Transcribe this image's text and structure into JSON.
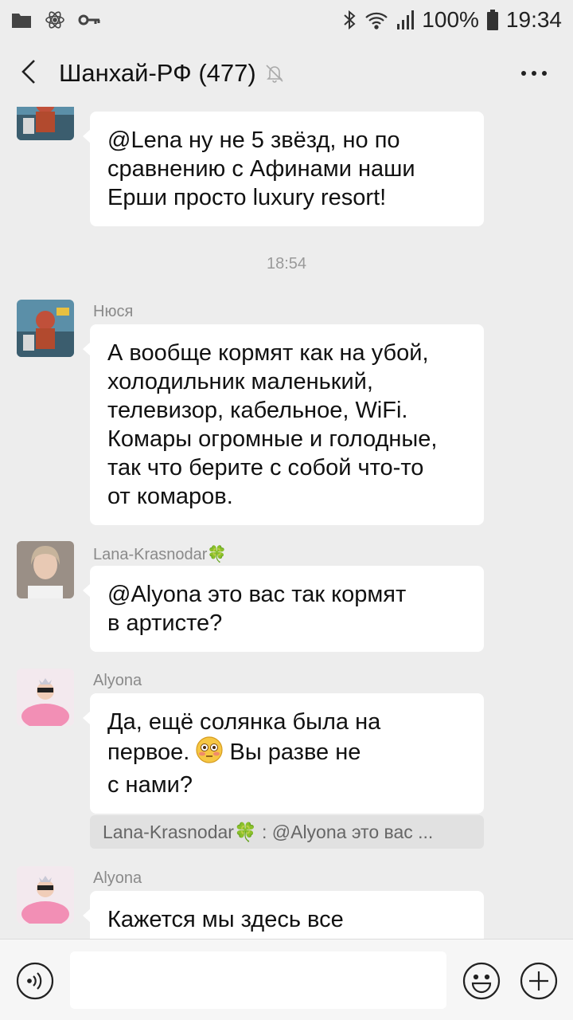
{
  "status_bar": {
    "battery": "100%",
    "time": "19:34"
  },
  "header": {
    "title": "Шанхай-РФ (477)"
  },
  "messages": [
    {
      "lines": [
        "@Lena ну не 5 звёзд, но по",
        "сравнению с Афинами наши",
        "Ерши просто luxury resort!"
      ]
    },
    {
      "time": "18:54"
    },
    {
      "sender": "Нюся",
      "lines": [
        "А вообще кормят как на убой,",
        "холодильник маленький,",
        "телевизор, кабельное, WiFi.",
        "Комары огромные и голодные,",
        "так что берите с собой что-то",
        "от комаров."
      ]
    },
    {
      "sender": "Lana-Krasnodar🍀",
      "lines": [
        "@Alyona это вас так кормят",
        "в артисте?"
      ]
    },
    {
      "sender": "Alyona",
      "line1": "Да, ещё солянка была на",
      "line2_a": "первое.",
      "line2_b": "Вы разве не",
      "line3": "с нами?",
      "quote": "Lana-Krasnodar🍀 : @Alyona это вас ..."
    },
    {
      "sender": "Alyona",
      "lines": [
        "Кажется мы здесь все"
      ]
    }
  ],
  "icons": {
    "folder": "folder-icon",
    "react": "atom-icon",
    "key": "key-icon",
    "bluetooth": "bluetooth-icon",
    "wifi": "wifi-icon",
    "signal": "signal-icon",
    "battery": "battery-icon",
    "back": "chevron-left-icon",
    "mute": "bell-off-icon",
    "more": "more-dots-icon",
    "voice": "voice-icon",
    "emoji": "smiley-icon",
    "plus": "plus-icon"
  },
  "colors": {
    "background": "#ededed",
    "bubble": "#ffffff",
    "quote_bg": "#e1e1e1"
  }
}
